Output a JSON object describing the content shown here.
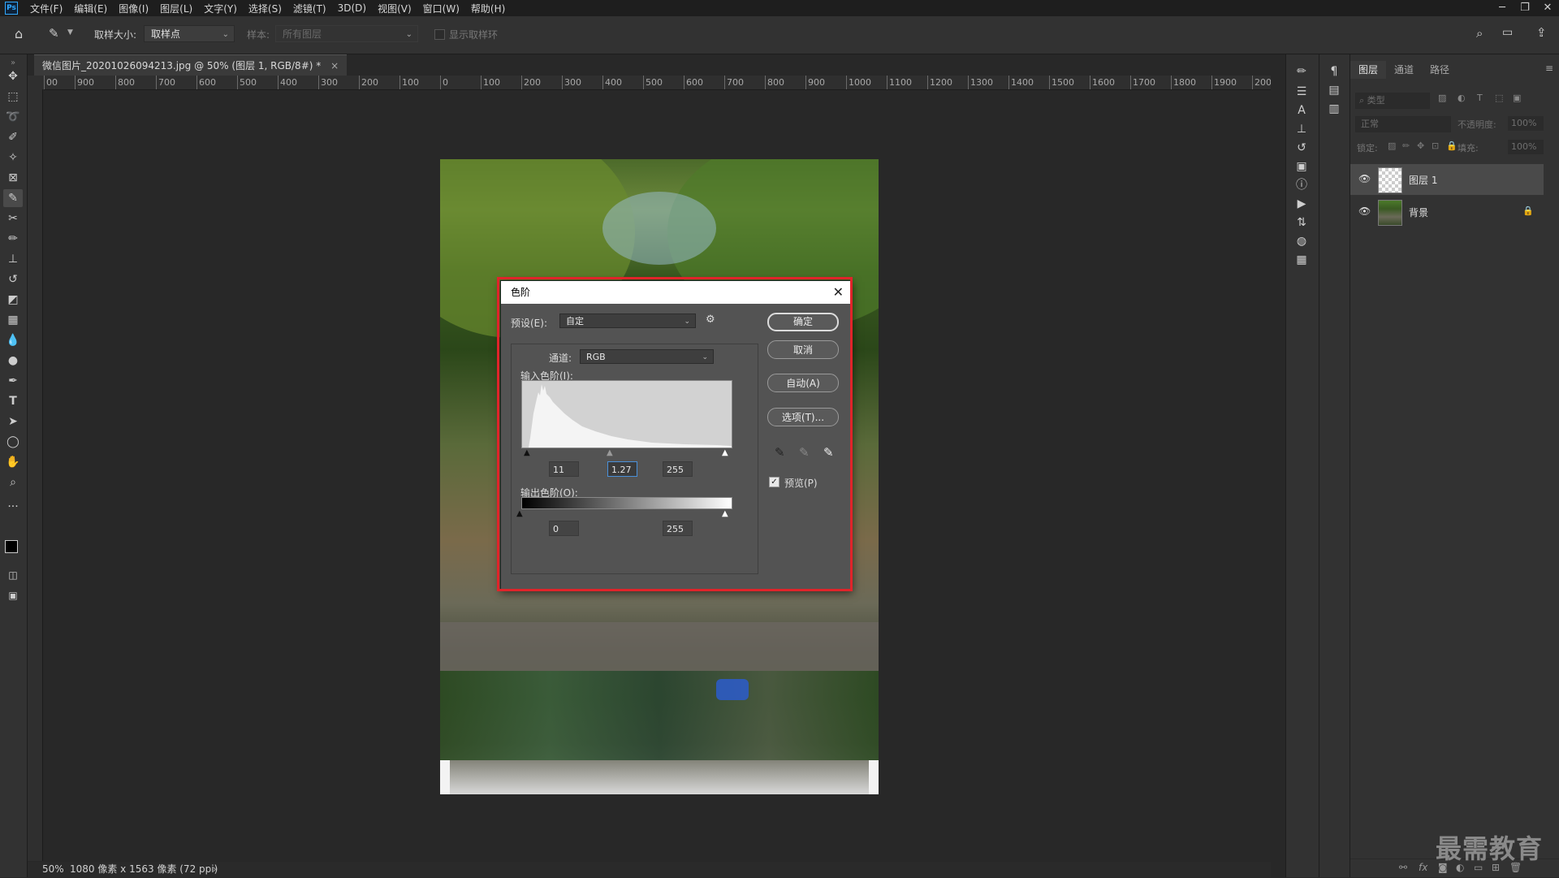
{
  "app": {
    "logo": "Ps"
  },
  "menu": [
    "文件(F)",
    "编辑(E)",
    "图像(I)",
    "图层(L)",
    "文字(Y)",
    "选择(S)",
    "滤镜(T)",
    "3D(D)",
    "视图(V)",
    "窗口(W)",
    "帮助(H)"
  ],
  "window_controls": {
    "minimize": "─",
    "restore": "❐",
    "close": "✕"
  },
  "options": {
    "sample_size_label": "取样大小:",
    "sample_size_value": "取样点",
    "sample_label": "样本:",
    "sample_value": "所有图层",
    "show_ring_label": "显示取样环"
  },
  "document": {
    "tab_title": "微信图片_20201026094213.jpg @ 50% (图层 1, RGB/8#) *",
    "tab_close": "×",
    "zoom": "50%",
    "size_info": "1080 像素 x 1563 像素 (72 ppi)"
  },
  "ruler_top_labels": [
    "00",
    "900",
    "800",
    "700",
    "600",
    "500",
    "400",
    "300",
    "200",
    "100",
    "0",
    "100",
    "200",
    "300",
    "400",
    "500",
    "600",
    "700",
    "800",
    "900",
    "1000",
    "1100",
    "1200",
    "1300",
    "1400",
    "1500",
    "1600",
    "1700",
    "1800",
    "1900",
    "200"
  ],
  "layers_panel": {
    "tabs": [
      "图层",
      "通道",
      "路径"
    ],
    "filter_placeholder": "类型",
    "blend_mode": "正常",
    "opacity_label": "不透明度:",
    "opacity_value": "100%",
    "lock_label": "锁定:",
    "fill_label": "填充:",
    "fill_value": "100%",
    "layers": [
      {
        "name": "图层 1",
        "selected": true
      },
      {
        "name": "背景",
        "selected": false
      }
    ]
  },
  "levels_dialog": {
    "title": "色阶",
    "preset_label": "预设(E):",
    "preset_value": "自定",
    "channel_label": "通道:",
    "channel_value": "RGB",
    "input_levels_label": "输入色阶(I):",
    "input_black": "11",
    "input_gamma": "1.27",
    "input_white": "255",
    "output_levels_label": "输出色阶(O):",
    "output_black": "0",
    "output_white": "255",
    "buttons": {
      "ok": "确定",
      "cancel": "取消",
      "auto": "自动(A)",
      "options": "选项(T)..."
    },
    "preview_label": "预览(P)",
    "preview_checked": true
  },
  "watermark": "最需教育"
}
